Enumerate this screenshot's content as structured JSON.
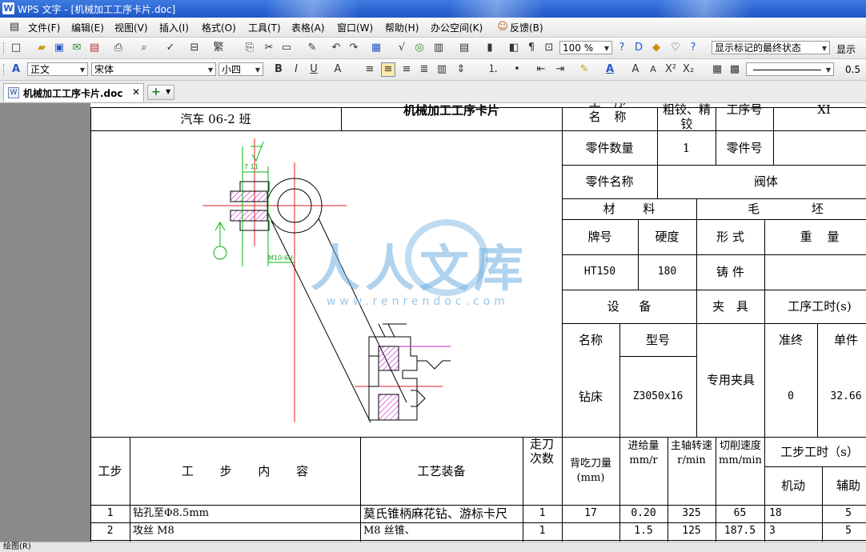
{
  "window": {
    "title": "WPS 文字 - [机械加工工序卡片.doc]",
    "app_icon": "W"
  },
  "menu": [
    "文件(F)",
    "编辑(E)",
    "视图(V)",
    "插入(I)",
    "格式(O)",
    "工具(T)",
    "表格(A)",
    "窗口(W)",
    "帮助(H)",
    "办公空间(K)",
    "反馈(B)"
  ],
  "toolbar": {
    "zoom": "100 %",
    "markup": "显示标记的最终状态",
    "show": "显示"
  },
  "format": {
    "style": "正文",
    "font": "宋体",
    "size": "小四",
    "line_width": "0.5"
  },
  "tabs": [
    {
      "label": "机械加工工序卡片.doc"
    }
  ],
  "status": {
    "draw": "绘图(R)"
  },
  "colors": {
    "accent": "#2458c9",
    "drawing_red": "#e02020",
    "drawing_magenta": "#d020d0",
    "drawing_green": "#10b010"
  },
  "card": {
    "class_name": "汽车 06-2 班",
    "card_title": "机械加工工序卡片",
    "proc_name_label": "工 序 名 称",
    "proc_name_value": "钻、扩、粗铰、精铰",
    "proc_no_label": "工序号",
    "proc_no_value": "XI",
    "qty_label": "零件数量",
    "qty_value": "1",
    "part_no_label": "零件号",
    "part_name_label": "零件名称",
    "part_name_value": "阀体",
    "material_label": "材 料",
    "blank_label": "毛 坯",
    "grade_label": "牌号",
    "hardness_label": "硬度",
    "form_label": "形 式",
    "weight_label": "重 量",
    "grade_value": "HT150",
    "hardness_value": "180",
    "form_value": "铸 件",
    "equip_label": "设 备",
    "fixture_label": "夹 具",
    "time_label": "工序工时(s)",
    "eq_name_label": "名称",
    "eq_model_label": "型号",
    "prep_label": "准终",
    "unit_label": "单件",
    "eq_name_value": "钻床",
    "eq_model_value": "Z3050x16",
    "fixture_value": "专用夹具",
    "prep_value": "0",
    "unit_value": "32.66"
  },
  "steps": {
    "h_step": "工步",
    "h_content": "工 步 内 容",
    "h_equip": "工艺装备",
    "h_passes": "走刀次数",
    "h_depth": "背吃刀量(mm)",
    "h_feed": "进给量 mm/r",
    "h_speed": "主轴转速 r/min",
    "h_cut": "切削速度 mm/min",
    "h_time": "工步工时（s）",
    "h_machine": "机动",
    "h_aux": "辅助",
    "rows": [
      {
        "no": "1",
        "content": "钻孔至Φ8.5mm",
        "equip": "莫氏锥柄麻花钻、游标卡尺",
        "passes": "1",
        "depth": "17",
        "feed": "0.20",
        "speed": "325",
        "cut": "65",
        "machine": "18",
        "aux": "5"
      },
      {
        "no": "2",
        "content": "攻丝 M8",
        "equip": "M8 丝锥、",
        "passes": "1",
        "depth": "",
        "feed": "1.5",
        "speed": "125",
        "cut": "187.5",
        "machine": "3",
        "aux": "5"
      }
    ]
  },
  "drawing": {
    "dim_m10": "M10-6H",
    "dim_top": "7 11"
  },
  "watermark": {
    "text": "人人文库",
    "url": "www.renrendoc.com"
  }
}
